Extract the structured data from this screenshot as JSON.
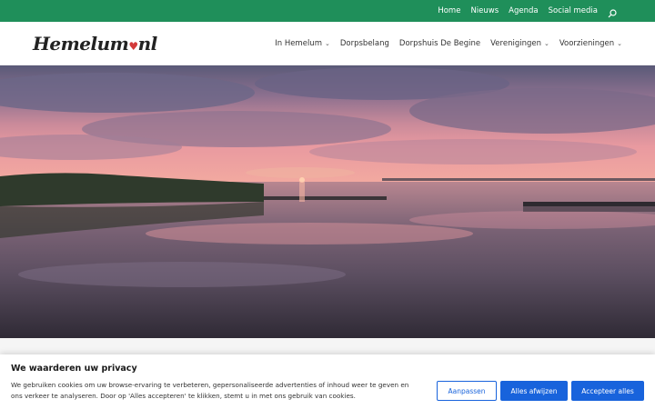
{
  "topbar": {
    "links": [
      "Home",
      "Nieuws",
      "Agenda",
      "Social media"
    ],
    "search_icon": "search-icon",
    "color": "#1f8f5a"
  },
  "header": {
    "logo_text": "Hemelum",
    "logo_suffix": "nl",
    "nav": [
      {
        "label": "In Hemelum",
        "dropdown": true
      },
      {
        "label": "Dorpsbelang",
        "dropdown": false
      },
      {
        "label": "Dorpshuis De Begine",
        "dropdown": false
      },
      {
        "label": "Verenigingen",
        "dropdown": true
      },
      {
        "label": "Voorzieningen",
        "dropdown": true
      }
    ]
  },
  "cookie": {
    "title": "We waarderen uw privacy",
    "text": "We gebruiken cookies om uw browse-ervaring te verbeteren, gepersonaliseerde advertenties of inhoud weer te geven en ons verkeer te analyseren. Door op 'Alles accepteren' te klikken, stemt u in met ons gebruik van cookies.",
    "customize_label": "Aanpassen",
    "reject_label": "Alles afwijzen",
    "accept_label": "Accepteer alles",
    "accent": "#1863dc"
  }
}
